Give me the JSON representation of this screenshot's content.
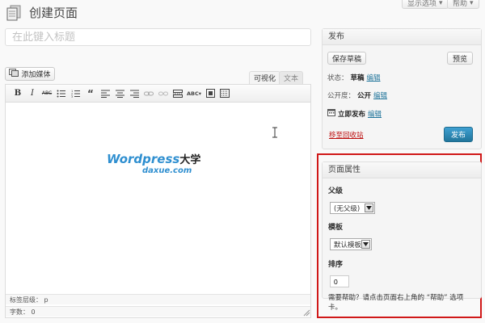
{
  "top_tabs": {
    "screen_options": "显示选项",
    "help": "帮助"
  },
  "header": {
    "title": "创建页面"
  },
  "title_field": {
    "placeholder": "在此键入标题"
  },
  "editor": {
    "add_media_label": "添加媒体",
    "tabs": [
      {
        "label": "可视化"
      },
      {
        "label": "文本"
      }
    ],
    "toolbar_icons": [
      "bold-icon",
      "italic-icon",
      "strikethrough-icon",
      "bullet-list-icon",
      "numbered-list-icon",
      "blockquote-icon",
      "align-left-icon",
      "align-center-icon",
      "align-right-icon",
      "link-icon",
      "unlink-icon",
      "more-tag-icon",
      "spellcheck-icon",
      "fullscreen-icon",
      "kitchen-sink-icon"
    ],
    "tag_path_label": "标签层级：",
    "tag_path_value": "p",
    "word_count_label": "字数：",
    "word_count_value": "0",
    "watermark": {
      "word_top": "Wordpress",
      "word_cn": "大学",
      "word_bottom": "daxue.com"
    }
  },
  "publish_box": {
    "title": "发布",
    "save_draft_label": "保存草稿",
    "preview_label": "预览",
    "status_label": "状态：",
    "status_value": "草稿",
    "visibility_label": "公开度：",
    "visibility_value": "公开",
    "schedule_value": "立即发布",
    "edit_link": "编辑",
    "trash_link": "移至回收站",
    "publish_label": "发布"
  },
  "page_attributes": {
    "title": "页面属性",
    "parent_label": "父级",
    "parent_value": "(无父级)",
    "template_label": "模板",
    "template_value": "默认模板",
    "order_label": "排序",
    "order_value": "0",
    "help_text": "需要帮助？请点击页面右上角的 “帮助” 选项卡。"
  },
  "colors": {
    "accent": "#21759b",
    "highlight_frame": "#d01818",
    "trash": "#bc0b0b"
  }
}
